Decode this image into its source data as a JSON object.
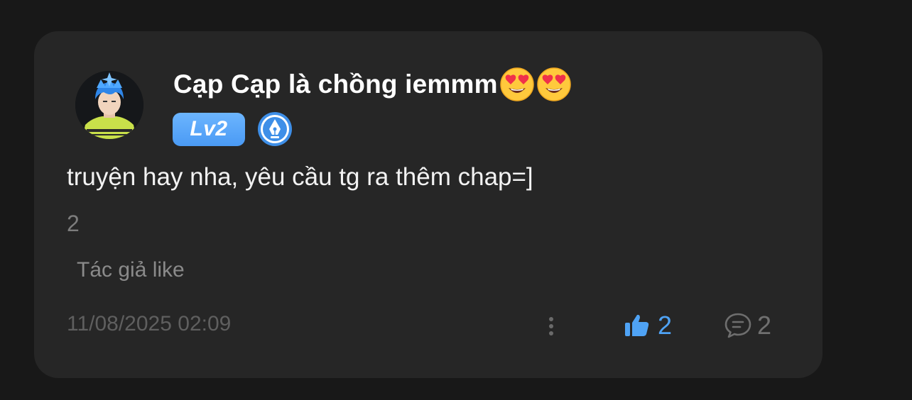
{
  "comment": {
    "author": {
      "name": "Cạp Cạp là chồng iemmm",
      "name_emojis": [
        "heart-eyes-emoji",
        "heart-eyes-emoji"
      ],
      "avatar": "user-avatar",
      "level_badge": "Lv2",
      "role_icon": "pen-nib-badge-icon"
    },
    "text": "truyện hay nha, yêu cầu tg ra thêm chap=]",
    "count": "2",
    "author_like": "Tác giả like",
    "timestamp": "11/08/2025 02:09",
    "actions": {
      "more_icon": "more-vertical-icon",
      "like_icon": "thumbs-up-icon",
      "like_count": "2",
      "reply_icon": "comment-bubble-icon",
      "reply_count": "2"
    }
  },
  "colors": {
    "background": "#181818",
    "card": "#262626",
    "accent_blue": "#4fa3f5",
    "text_primary": "#ffffff",
    "text_muted": "#7d7d7d"
  }
}
